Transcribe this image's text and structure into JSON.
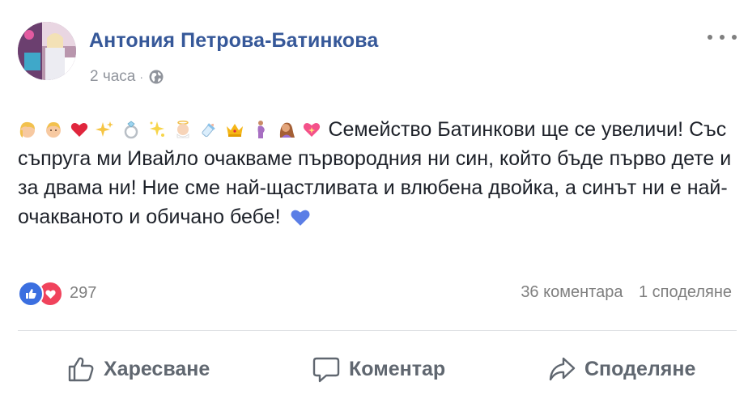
{
  "post": {
    "author": "Антония Петрова-Батинкова",
    "time": "2 часа",
    "separator": "·",
    "privacy_icon": "globe-icon",
    "menu_icon": "more-options-icon",
    "emojis": [
      "woman-blond-icon",
      "man-blond-icon",
      "red-heart-icon",
      "sparkles-icon",
      "ring-icon",
      "dizzy-sparkle-icon",
      "baby-angel-icon",
      "baby-bottle-icon",
      "crown-icon",
      "pregnant-woman-icon",
      "woman-hair-icon",
      "sparkling-heart-icon"
    ],
    "text_line1": "Семейство Батинкови ще се увеличи!",
    "text_body": "Със съпруга ми Ивайло очакваме първородния ни син, който бъде първо дете и за двама ни! Ние сме най-щастливата и влюбена двойка, а синът ни е най-очакваното и обичано бебе!",
    "trailing_emoji": "blue-heart-icon"
  },
  "reactions": {
    "count": "297",
    "types": [
      "like-icon",
      "love-icon"
    ]
  },
  "stats": {
    "comments": "36 коментара",
    "shares": "1 споделяне"
  },
  "actions": {
    "like": "Харесване",
    "comment": "Коментар",
    "share": "Споделяне"
  },
  "colors": {
    "author": "#365899",
    "meta": "#90949c",
    "action_text": "#606770",
    "like_reaction": "#3b6fe0",
    "love_reaction": "#f0435c",
    "blue_heart": "#5b7ee6"
  }
}
